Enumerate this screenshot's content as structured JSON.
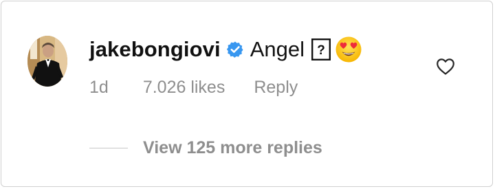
{
  "comment": {
    "username": "jakebongiovi",
    "verified": true,
    "text": "Angel",
    "glyph_fallback": "?",
    "emoji": "smiling-face-with-heart-eyes",
    "time": "1d",
    "likes": "7.026 likes",
    "reply_label": "Reply",
    "view_replies_label": "View 125 more replies"
  },
  "colors": {
    "text_primary": "#111111",
    "text_secondary": "#8e8e8e",
    "verified_blue": "#3897f0",
    "border": "#cfcfcf"
  }
}
